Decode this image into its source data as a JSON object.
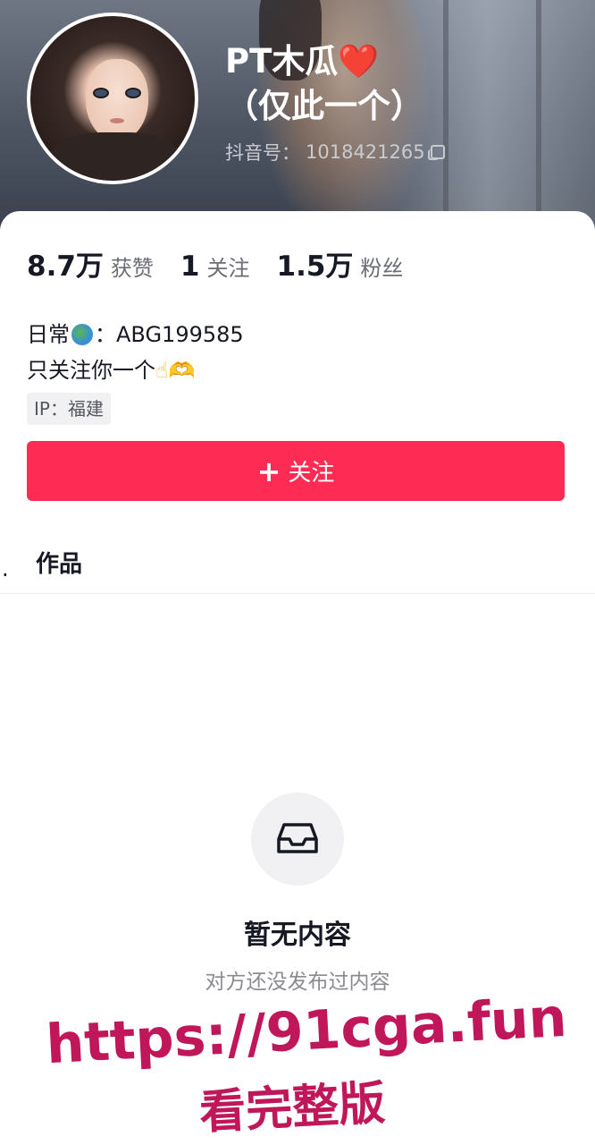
{
  "profile": {
    "nickname": "PT木瓜❤️（仅此一个）",
    "nickname_parts": [
      "PT木瓜",
      "❤️",
      "（仅此一个）"
    ],
    "douyin_id_label": "抖音号：",
    "douyin_id": "1018421265",
    "copy_icon": "copy-icon"
  },
  "stats": [
    {
      "value": "8.7万",
      "label": "获赞"
    },
    {
      "value": "1",
      "label": "关注"
    },
    {
      "value": "1.5万",
      "label": "粉丝"
    }
  ],
  "bio": {
    "line1_prefix": "日常",
    "line1_suffix": "：ABG199585",
    "line2": "只关注你一个",
    "line2_emoji": "☝🫶"
  },
  "ip_tag": "IP：福建",
  "follow_button": {
    "label": "关注",
    "icon": "plus-icon"
  },
  "tabs": [
    {
      "label": "作品",
      "active": true
    }
  ],
  "tab_leading_mark": ".",
  "empty_state": {
    "icon": "inbox-icon",
    "title": "暂无内容",
    "description": "对方还没发布过内容"
  },
  "watermark": {
    "line1": "https://91cga.fun",
    "line2": "看完整版"
  },
  "colors": {
    "accent": "#fe2c55",
    "watermark": "#c0175a",
    "text_primary": "#161823",
    "text_secondary": "#8a8b91"
  }
}
